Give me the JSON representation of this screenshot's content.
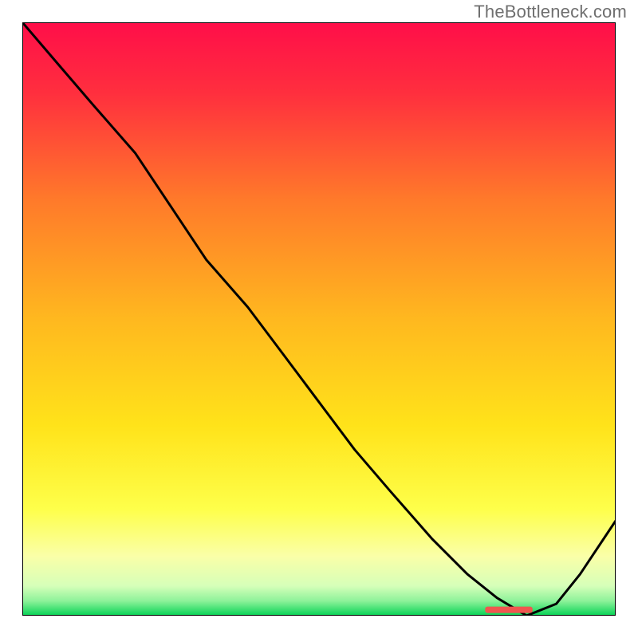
{
  "watermark": "TheBottleneck.com",
  "chart_data": {
    "type": "line",
    "title": "",
    "xlabel": "",
    "ylabel": "",
    "xlim": [
      0,
      100
    ],
    "ylim": [
      0,
      100
    ],
    "grid": false,
    "colors": {
      "gradient_top": "#ff0e49",
      "gradient_mid": "#ffd400",
      "gradient_low": "#fbffb0",
      "gradient_bottom": "#06d355",
      "line": "#000000",
      "marker_fill": "#f0564f"
    },
    "series": [
      {
        "name": "curve",
        "x": [
          0,
          6,
          12,
          19,
          25,
          31,
          38,
          44,
          50,
          56,
          62,
          69,
          75,
          80,
          85,
          90,
          94,
          100
        ],
        "values": [
          100,
          93,
          86,
          78,
          69,
          60,
          52,
          44,
          36,
          28,
          21,
          13,
          7,
          3,
          0,
          2,
          7,
          16
        ]
      }
    ],
    "marker": {
      "name": "highlight-segment",
      "position_pct": [
        78,
        86
      ],
      "value": 1.0
    }
  }
}
